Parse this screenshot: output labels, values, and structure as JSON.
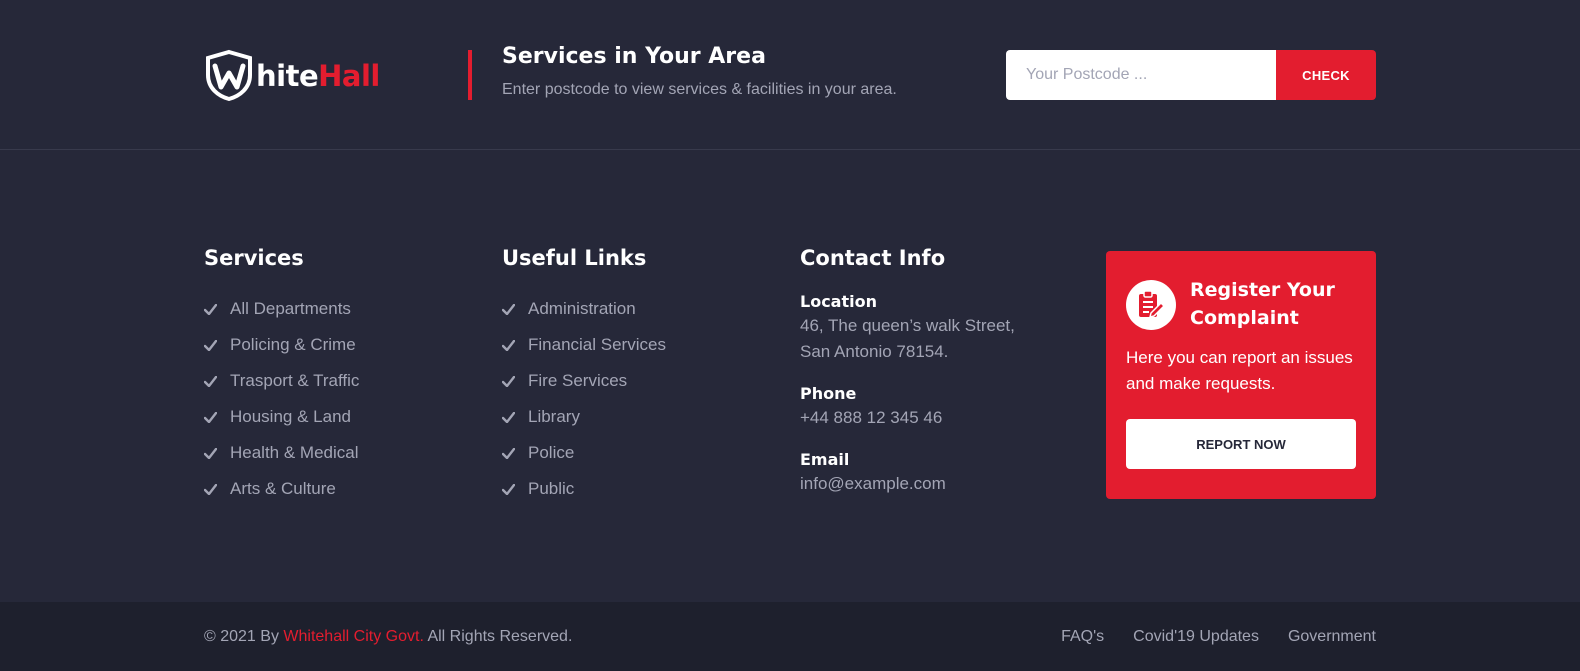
{
  "brand": {
    "logo_part1": "hite",
    "logo_part2": "Hall",
    "logo_initial": "W"
  },
  "area": {
    "title": "Services in Your Area",
    "subtitle": "Enter postcode to view services & facilities in your area.",
    "placeholder": "Your Postcode ...",
    "check_label": "CHECK"
  },
  "services": {
    "title": "Services",
    "items": [
      {
        "label": "All Departments"
      },
      {
        "label": "Policing & Crime"
      },
      {
        "label": "Trasport & Traffic"
      },
      {
        "label": "Housing & Land"
      },
      {
        "label": "Health & Medical"
      },
      {
        "label": "Arts & Culture"
      }
    ]
  },
  "useful_links": {
    "title": "Useful Links",
    "items": [
      {
        "label": "Administration"
      },
      {
        "label": "Financial Services"
      },
      {
        "label": "Fire Services"
      },
      {
        "label": "Library"
      },
      {
        "label": "Police"
      },
      {
        "label": "Public"
      }
    ]
  },
  "contact": {
    "title": "Contact Info",
    "location_label": "Location",
    "location_line1": "46, The queen’s walk Street,",
    "location_line2": "San Antonio 78154.",
    "phone_label": "Phone",
    "phone_value": "+44 888 12 345 46",
    "email_label": "Email",
    "email_value": "info@example.com"
  },
  "complaint": {
    "title": "Register Your Complaint",
    "text": "Here you can report an issues and make requests.",
    "button_label": "REPORT NOW",
    "icon": "clipboard-edit-icon"
  },
  "footer": {
    "copyright_prefix": "© 2021 By",
    "copyright_brand": "Whitehall City Govt.",
    "copyright_suffix": "All Rights Reserved.",
    "links": [
      {
        "label": "FAQ's"
      },
      {
        "label": "Covid'19 Updates"
      },
      {
        "label": "Government"
      }
    ]
  },
  "colors": {
    "background": "#262839",
    "bottom_bar": "#1e202d",
    "accent": "#e31d2f",
    "text_muted": "#a3a5b5",
    "heading": "#ffffff"
  }
}
